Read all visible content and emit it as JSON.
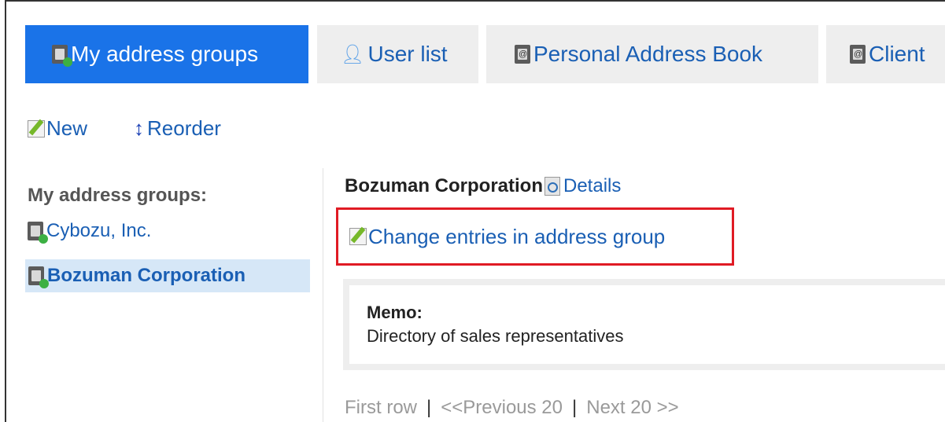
{
  "tabs": [
    {
      "label": "My address groups",
      "active": true,
      "icon": "address-group-icon"
    },
    {
      "label": "User list",
      "active": false,
      "icon": "user-icon"
    },
    {
      "label": "Personal Address Book",
      "active": false,
      "icon": "address-book-icon"
    },
    {
      "label": "Client",
      "active": false,
      "icon": "address-book-icon"
    }
  ],
  "toolbar": {
    "new_label": "New",
    "reorder_label": "Reorder"
  },
  "sidebar": {
    "title": "My address groups:",
    "groups": [
      {
        "label": "Cybozu, Inc.",
        "selected": false
      },
      {
        "label": "Bozuman Corporation",
        "selected": true
      }
    ]
  },
  "main": {
    "group_name": "Bozuman Corporation",
    "details_label": "Details",
    "change_entries_label": "Change entries in address group",
    "memo_label": "Memo:",
    "memo_text": "Directory of sales representatives",
    "pager": {
      "first": "First row",
      "separator": "|",
      "previous": "<<Previous 20",
      "next": "Next 20 >>"
    }
  },
  "colors": {
    "accent": "#1a73e8",
    "link": "#1a5fb4",
    "highlight_border": "#e01b24",
    "selected_bg": "#d6e7f7"
  }
}
